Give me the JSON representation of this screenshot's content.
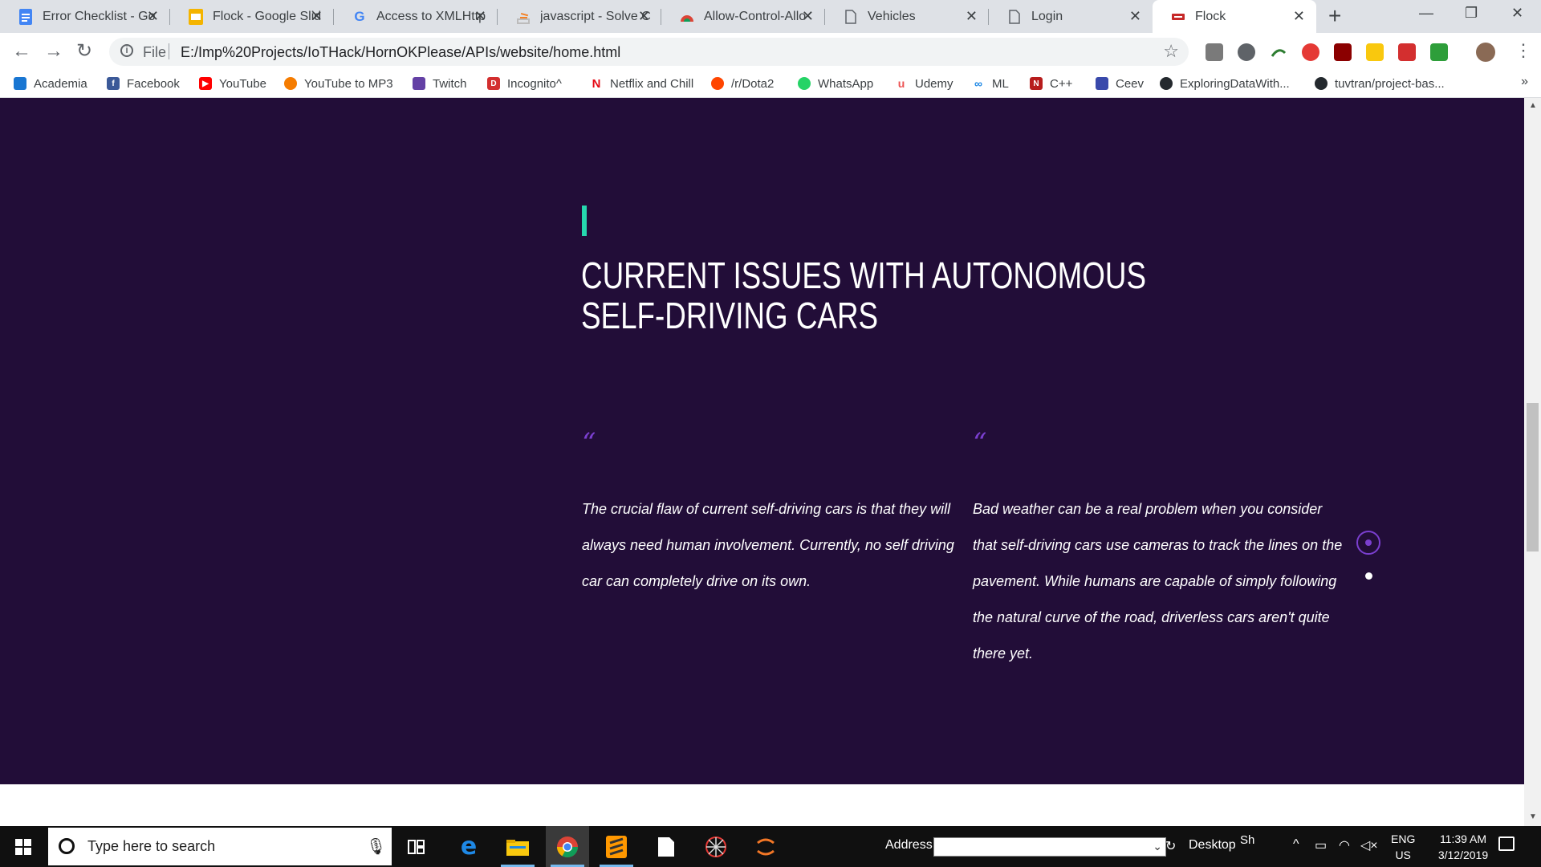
{
  "browser": {
    "tabs": [
      {
        "title": "Error Checklist - Go",
        "icon": "google-docs-icon",
        "color": "#4285f4"
      },
      {
        "title": "Flock - Google Slid",
        "icon": "google-slides-icon",
        "color": "#f4b400"
      },
      {
        "title": "Access to XMLHttp",
        "icon": "google-g-icon",
        "color": "#4285f4"
      },
      {
        "title": "javascript - Solve C",
        "icon": "stackoverflow-icon",
        "color": "#f48024"
      },
      {
        "title": "Allow-Control-Allo",
        "icon": "chrome-webstore-icon",
        "color": "#db4437"
      },
      {
        "title": "Vehicles",
        "icon": "file-icon",
        "color": "#5f6368"
      },
      {
        "title": "Login",
        "icon": "file-icon",
        "color": "#5f6368"
      },
      {
        "title": "Flock",
        "icon": "flock-favicon-icon",
        "color": "#c62828"
      }
    ],
    "active_tab": 7,
    "new_tab_symbol": "+",
    "window_controls": {
      "minimize": "—",
      "restore": "❐",
      "close": "✕"
    },
    "omnibox": {
      "scheme": "File",
      "url": "E:/Imp%20Projects/IoTHack/HornOKPlease/APIs/website/home.html"
    },
    "bookmarks": [
      {
        "label": "Academia",
        "icon": "academia-icon",
        "color": "#1976d2"
      },
      {
        "label": "Facebook",
        "icon": "facebook-icon",
        "color": "#3b5998"
      },
      {
        "label": "YouTube",
        "icon": "youtube-icon",
        "color": "#ff0000"
      },
      {
        "label": "YouTube to MP3",
        "icon": "yt-mp3-icon",
        "color": "#f57c00"
      },
      {
        "label": "Twitch",
        "icon": "twitch-icon",
        "color": "#6441a5"
      },
      {
        "label": "Incognito^",
        "icon": "incognito-icon",
        "color": "#d32f2f"
      },
      {
        "label": "Netflix and Chill",
        "icon": "netflix-icon",
        "color": "#e50914"
      },
      {
        "label": "/r/Dota2",
        "icon": "reddit-icon",
        "color": "#ff4500"
      },
      {
        "label": "WhatsApp",
        "icon": "whatsapp-icon",
        "color": "#25d366"
      },
      {
        "label": "Udemy",
        "icon": "udemy-icon",
        "color": "#ec5252"
      },
      {
        "label": "ML",
        "icon": "ml-icon",
        "color": "#1e88e5"
      },
      {
        "label": "C++",
        "icon": "cpp-icon",
        "color": "#b71c1c"
      },
      {
        "label": "Ceev",
        "icon": "ceev-icon",
        "color": "#3949ab"
      },
      {
        "label": "ExploringDataWith...",
        "icon": "github-icon",
        "color": "#24292e"
      },
      {
        "label": "tuvtran/project-bas...",
        "icon": "github-icon",
        "color": "#24292e"
      }
    ],
    "bookmarks_overflow": "»"
  },
  "page": {
    "heading": "CURRENT ISSUES WITH AUTONOMOUS SELF-DRIVING CARS",
    "quote_mark": "“",
    "quotes": [
      "The crucial flaw of current self-driving cars is that they will always need human involvement. Currently, no self driving car can completely drive on its own.",
      "Bad weather can be a real problem when you consider that self-driving cars use cameras to track the lines on the pavement. While humans are capable of simply following the natural curve of the road, driverless cars aren't quite there yet."
    ],
    "slider": {
      "count": 2,
      "active_index": 0
    },
    "colors": {
      "background": "#220d38",
      "accent": "#26d7ae",
      "quote_mark": "#7b3fd0"
    }
  },
  "taskbar": {
    "search_placeholder": "Type here to search",
    "apps": [
      "task-view-icon",
      "edge-icon",
      "file-explorer-icon",
      "chrome-icon",
      "sublime-text-icon",
      "notepad-icon",
      "spider-app-icon",
      "jupyter-icon"
    ],
    "address_label": "Address",
    "desktop_label": "Desktop",
    "sh_label": "Sh",
    "lang_line1": "ENG",
    "lang_line2": "US",
    "time": "11:39 AM",
    "date": "3/12/2019"
  }
}
